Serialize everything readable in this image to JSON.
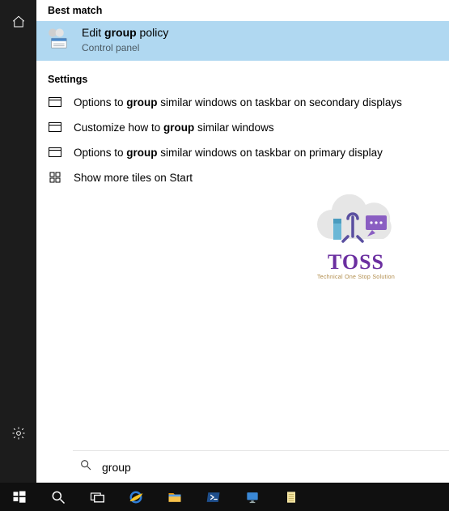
{
  "headers": {
    "best_match": "Best match",
    "settings": "Settings"
  },
  "best_match": {
    "title_pre": "Edit ",
    "title_bold": "group",
    "title_post": " policy",
    "subtitle": "Control panel"
  },
  "settings_items": [
    {
      "icon": "window",
      "pre": "Options to ",
      "bold": "group",
      "post": " similar windows on taskbar on secondary displays"
    },
    {
      "icon": "window",
      "pre": "Customize how to ",
      "bold": "group",
      "post": " similar windows"
    },
    {
      "icon": "window",
      "pre": "Options to ",
      "bold": "group",
      "post": " similar windows on taskbar on primary display"
    },
    {
      "icon": "tiles",
      "pre": "Show more tiles on Start",
      "bold": "",
      "post": ""
    }
  ],
  "search": {
    "value": "group",
    "placeholder": ""
  },
  "watermark": {
    "title": "TOSS",
    "subtitle": "Technical One Stop Solution"
  },
  "taskbar": {
    "items": [
      {
        "name": "start",
        "label": "Start"
      },
      {
        "name": "search",
        "label": "Search"
      },
      {
        "name": "task-view",
        "label": "Task View"
      },
      {
        "name": "internet-explorer",
        "label": "Internet Explorer"
      },
      {
        "name": "file-explorer",
        "label": "File Explorer"
      },
      {
        "name": "powershell",
        "label": "PowerShell"
      },
      {
        "name": "remote-desktop",
        "label": "Remote Desktop"
      },
      {
        "name": "notepad",
        "label": "Notepad"
      }
    ]
  }
}
